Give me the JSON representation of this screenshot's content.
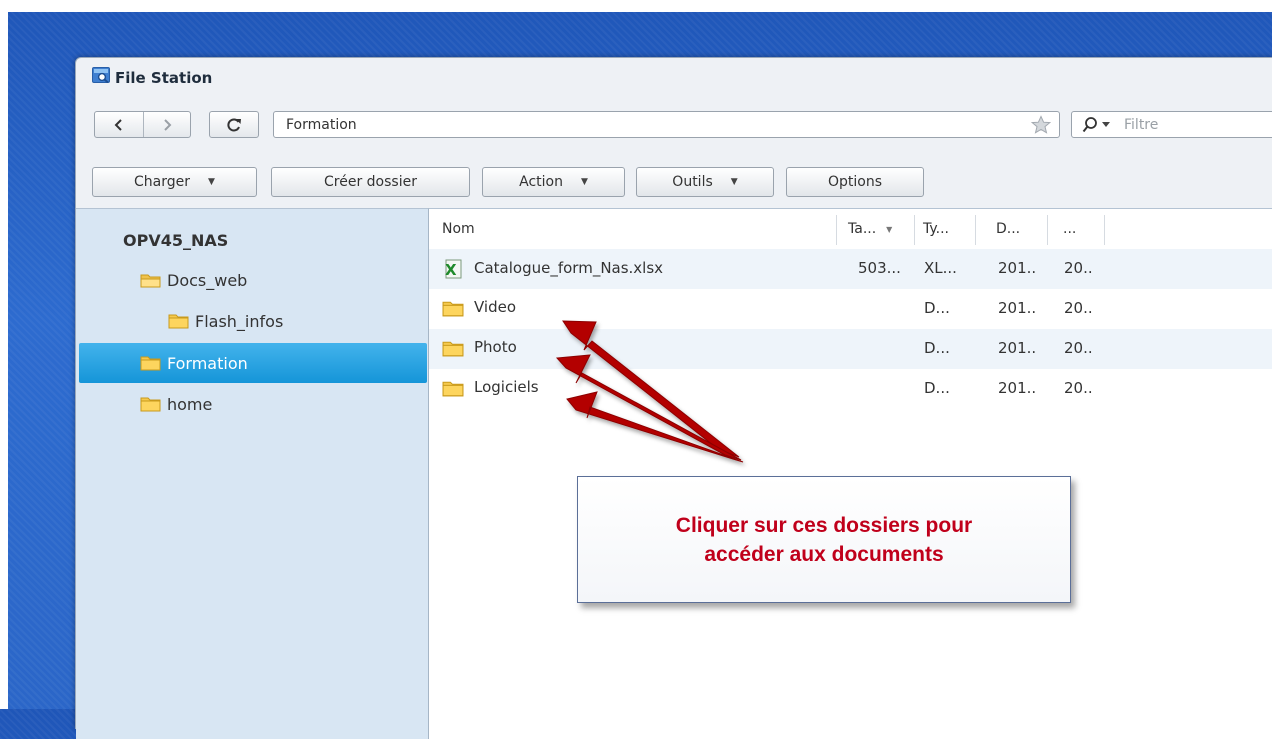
{
  "window": {
    "title": "File Station"
  },
  "addressbar": {
    "path": "Formation",
    "filter_placeholder": "Filtre"
  },
  "toolbar": {
    "upload_label": "Charger",
    "create_folder_label": "Créer dossier",
    "action_label": "Action",
    "tools_label": "Outils",
    "options_label": "Options"
  },
  "sidebar": {
    "root": "OPV45_NAS",
    "items": [
      {
        "label": "Docs_web"
      },
      {
        "label": "Flash_infos"
      },
      {
        "label": "Formation"
      },
      {
        "label": "home"
      }
    ]
  },
  "file_list": {
    "columns": [
      "Nom",
      "Ta...",
      "Ty...",
      "D...",
      "..."
    ],
    "rows": [
      {
        "name": "Catalogue_form_Nas.xlsx",
        "size": "503...",
        "type": "XL...",
        "date": "201..",
        "extra": "20.."
      },
      {
        "name": "Video",
        "size": "",
        "type": "D...",
        "date": "201..",
        "extra": "20.."
      },
      {
        "name": "Photo",
        "size": "",
        "type": "D...",
        "date": "201..",
        "extra": "20.."
      },
      {
        "name": "Logiciels",
        "size": "",
        "type": "D...",
        "date": "201..",
        "extra": "20.."
      }
    ]
  },
  "callout": {
    "text": "Cliquer sur ces dossiers pour accéder aux documents"
  },
  "colors": {
    "selected": "#1e9ee0",
    "callout_text": "#c0001b",
    "arrow": "#b30000",
    "desktop": "#2b66c8"
  }
}
